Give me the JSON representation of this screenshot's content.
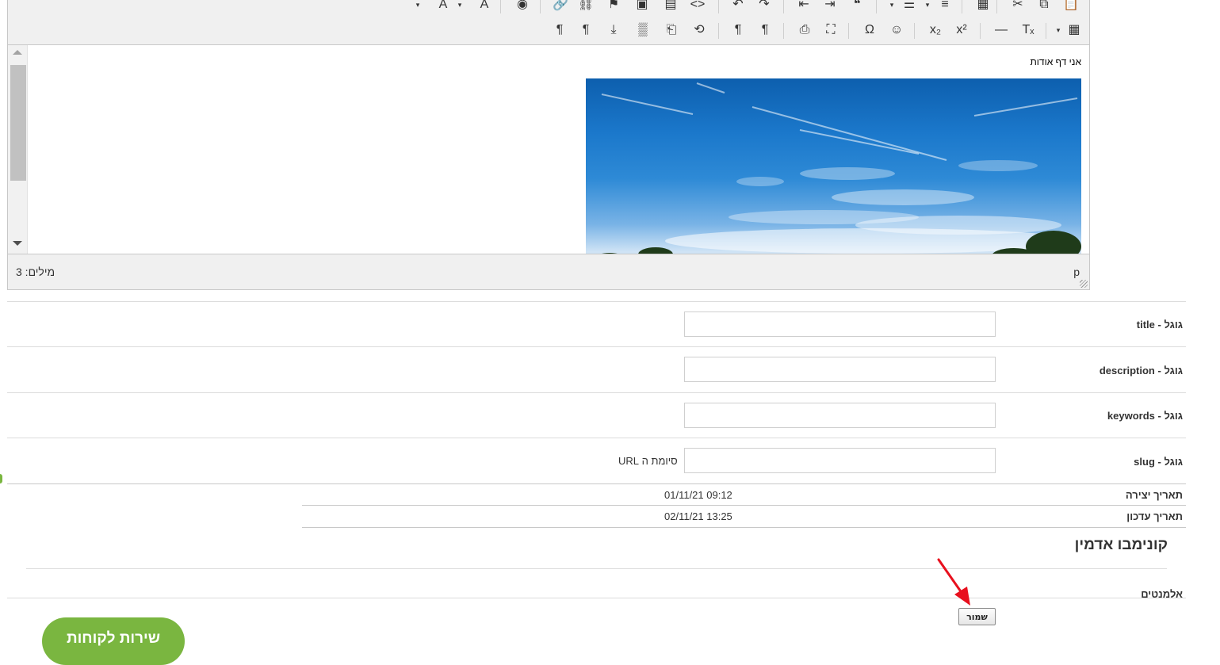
{
  "editor": {
    "toolbar_row1": [
      {
        "name": "text-color-caret",
        "glyph": "▾"
      },
      {
        "name": "text-color-icon",
        "glyph": "A"
      },
      {
        "name": "bg-color-caret",
        "glyph": "▾"
      },
      {
        "name": "bg-color-icon",
        "glyph": "A"
      },
      {
        "name": "preview-icon",
        "glyph": "◉"
      },
      {
        "name": "link-icon",
        "glyph": "🔗"
      },
      {
        "name": "unlink-icon",
        "glyph": "⛓"
      },
      {
        "name": "anchor-icon",
        "glyph": "⚑"
      },
      {
        "name": "image-icon",
        "glyph": "▣"
      },
      {
        "name": "media-icon",
        "glyph": "▤"
      },
      {
        "name": "code-icon",
        "glyph": "<>"
      },
      {
        "name": "undo-icon",
        "glyph": "↶"
      },
      {
        "name": "redo-icon",
        "glyph": "↷"
      },
      {
        "name": "outdent-icon",
        "glyph": "⇤"
      },
      {
        "name": "indent-icon",
        "glyph": "⇥"
      },
      {
        "name": "blockquote-icon",
        "glyph": "❝"
      },
      {
        "name": "bullet-list-caret",
        "glyph": "▾"
      },
      {
        "name": "bullet-list-icon",
        "glyph": "☰"
      },
      {
        "name": "numbered-list-caret",
        "glyph": "▾"
      },
      {
        "name": "numbered-list-icon",
        "glyph": "≡"
      },
      {
        "name": "template-icon",
        "glyph": "▦"
      },
      {
        "name": "cut-icon",
        "glyph": "✂"
      },
      {
        "name": "copy-icon",
        "glyph": "⧉"
      },
      {
        "name": "paste-icon",
        "glyph": "📋"
      }
    ],
    "toolbar_row2": [
      {
        "name": "ltr-paragraph-icon",
        "glyph": "¶"
      },
      {
        "name": "rtl-paragraph-icon",
        "glyph": "¶"
      },
      {
        "name": "insert-file-icon",
        "glyph": "⤓"
      },
      {
        "name": "visual-blocks-icon",
        "glyph": "▒"
      },
      {
        "name": "page-break-icon",
        "glyph": "⎗"
      },
      {
        "name": "restore-draft-icon",
        "glyph": "⟲"
      },
      {
        "name": "ltr-direction-icon",
        "glyph": "¶"
      },
      {
        "name": "rtl-direction-icon",
        "glyph": "¶"
      },
      {
        "name": "print-icon",
        "glyph": "⎙"
      },
      {
        "name": "fullscreen-icon",
        "glyph": "⛶"
      },
      {
        "name": "special-char-icon",
        "glyph": "Ω"
      },
      {
        "name": "emoticons-icon",
        "glyph": "☺"
      },
      {
        "name": "subscript-icon",
        "glyph": "x₂"
      },
      {
        "name": "superscript-icon",
        "glyph": "x²"
      },
      {
        "name": "horizontal-rule-icon",
        "glyph": "—"
      },
      {
        "name": "clear-format-icon",
        "glyph": "Tₓ"
      },
      {
        "name": "table-caret",
        "glyph": "▾"
      },
      {
        "name": "table-icon",
        "glyph": "▦"
      }
    ],
    "content_text": "אני דף אודות",
    "word_count": "מילים: 3",
    "path": "p"
  },
  "form": {
    "fields": [
      {
        "label": "גוגל - title",
        "value": ""
      },
      {
        "label": "גוגל - description",
        "value": ""
      },
      {
        "label": "גוגל - keywords",
        "value": ""
      },
      {
        "label": "גוגל - slug",
        "value": ""
      }
    ],
    "slug_suffix_note": "סיומת ה URL",
    "created_label": "תאריך יצירה",
    "created_value": "01/11/21 09:12",
    "updated_label": "תאריך עדכון",
    "updated_value": "02/11/21 13:25"
  },
  "section_title": "קונימבו אדמין",
  "elements_label": "אלמנטים",
  "save_label": "שמור",
  "support_label": "שירות לקוחות",
  "colors": {
    "accent_green": "#7ab640",
    "annotation_arrow": "#e8101e"
  }
}
